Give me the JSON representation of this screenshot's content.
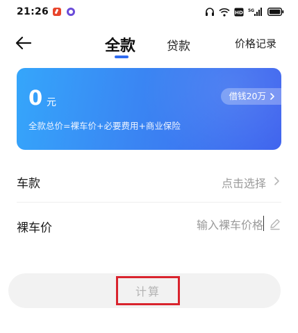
{
  "status_bar": {
    "time": "21:26",
    "icons": [
      "red-app-icon",
      "purple-app-icon",
      "headphones-icon",
      "wifi-icon",
      "hd-icon",
      "signal-icon",
      "battery-icon"
    ],
    "hd_text": "HD",
    "signal_text": "5G"
  },
  "header": {
    "tabs": [
      {
        "label": "全款",
        "active": true
      },
      {
        "label": "贷款",
        "active": false
      },
      {
        "label": "价格记录",
        "active": false
      }
    ],
    "accent_color": "#2f6bf0"
  },
  "price_card": {
    "amount": "0",
    "unit": "元",
    "formula": "全款总价=裸车价+必要费用+商业保险",
    "borrow_label": "借钱20万",
    "gradient": [
      "#35a6fb",
      "#3f63ee"
    ]
  },
  "form": {
    "car_model": {
      "label": "车款",
      "value": "点击选择"
    },
    "car_price": {
      "label": "裸车价",
      "placeholder": "输入裸车价格",
      "value": ""
    }
  },
  "actions": {
    "calculate_label": "计算",
    "highlight_color": "#d9232d"
  }
}
